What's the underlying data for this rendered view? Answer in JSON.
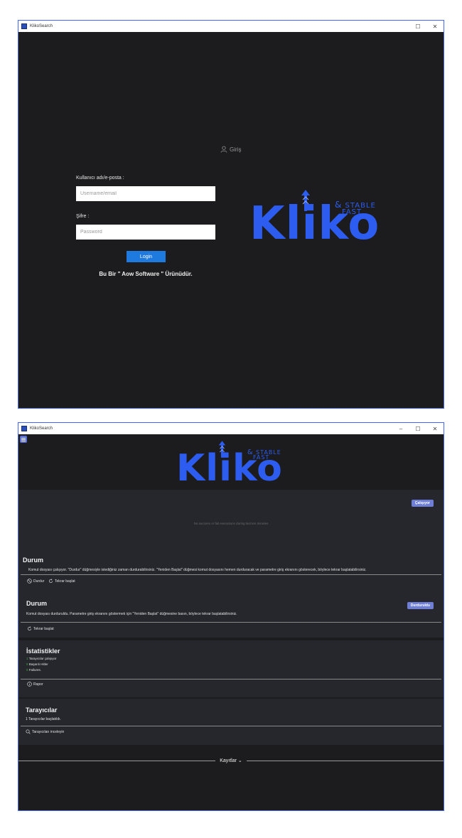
{
  "window1": {
    "title": "KlikoSearch",
    "login": {
      "header": "Giriş",
      "username_label": "Kullanıcı adı/e-posta :",
      "username_placeholder": "Username/email",
      "password_label": "Şifre :",
      "password_placeholder": "Password",
      "login_button": "Login",
      "tagline": "Bu Bir \" Aow Software \" Ürünüdür."
    },
    "logo": {
      "word": "Kliko",
      "stable": "STABLE",
      "fast": "FAST",
      "amp": "&"
    }
  },
  "window2": {
    "title": "KlikoSearch",
    "logo": {
      "word": "Kliko",
      "stable": "STABLE",
      "fast": "FAST",
      "amp": "&"
    },
    "status_badge_running": "Çalışıyor",
    "no_executions_message": "No success or fail executions during last ten minutes",
    "durum_running": {
      "title": "Durum",
      "text": "Komut dosyası çalışıyor. \"Durdur\" düğmesiyle istediğiniz zaman durdurabilirsiniz. \"Yeniden Başlat\" düğmesi komut dosyasını hemen durduracak ve parametre giriş ekranını gösterecek, böylece tekrar başlatabilirsiniz.",
      "stop_button": "Durdur",
      "restart_button": "Tekrar başlat"
    },
    "durum_stopped": {
      "title": "Durum",
      "badge": "Durduruldu",
      "text": "Komut dosyası durduruldu. Parametre giriş ekranını göstermek için \"Yeniden Başlat\" düğmesine basın, böylece tekrar başlatabilirsiniz.",
      "restart_button": "Tekrar başlat"
    },
    "stats": {
      "title": "İstatistikler",
      "items": [
        {
          "count": "1",
          "label": "Tarayıcılar çalışıyor"
        },
        {
          "count": "0",
          "label": "Başarılı Hitler"
        },
        {
          "count": "0",
          "label": "Failures."
        }
      ],
      "report_button": "Rapor"
    },
    "browsers": {
      "title": "Tarayıcılar",
      "text": "1 Tarayıcılar başlatıldı.",
      "inspect_button": "Tarayıcıları inceleyin"
    },
    "logs_label": "Kayıtlar"
  },
  "colors": {
    "accent": "#2c5cf0",
    "badge": "#6f7fd8",
    "login_button": "#1f7ae0"
  }
}
